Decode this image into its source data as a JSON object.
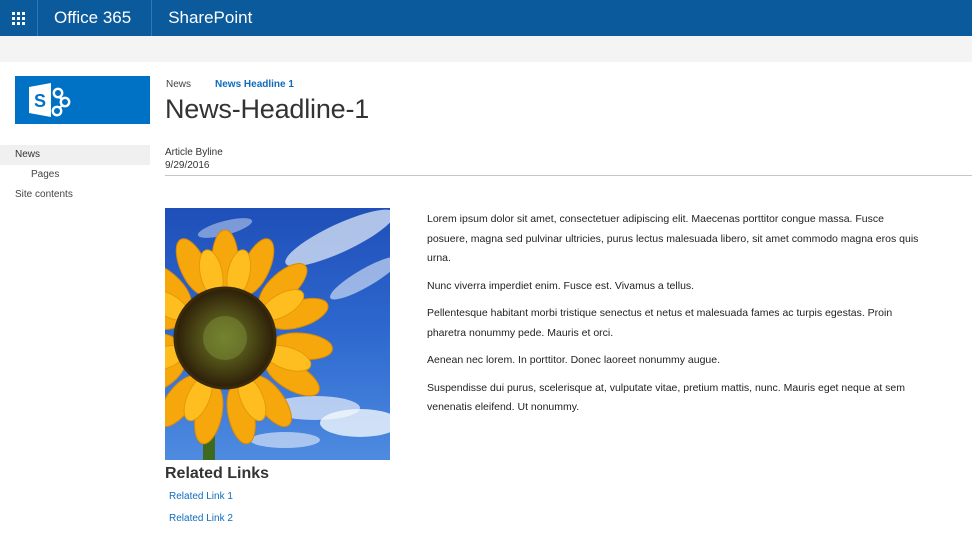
{
  "suite_bar": {
    "brand": "Office 365",
    "app": "SharePoint",
    "icon": "app-launcher-icon"
  },
  "site": {
    "logo_icon": "sharepoint-logo-icon",
    "logo_letter": "S",
    "logo_color": "#0072c6"
  },
  "breadcrumb": {
    "root": "News",
    "current": "News Headline 1"
  },
  "page": {
    "title": "News-Headline-1",
    "byline_label": "Article Byline",
    "date": "9/29/2016"
  },
  "left_nav": {
    "items": [
      {
        "label": "News"
      },
      {
        "label": "Pages"
      },
      {
        "label": "Site contents"
      }
    ]
  },
  "image": {
    "icon": "sunflower-image"
  },
  "related": {
    "title": "Related Links",
    "links": [
      {
        "label": "Related Link 1"
      },
      {
        "label": "Related Link 2"
      }
    ]
  },
  "article": {
    "paragraphs": [
      "Lorem ipsum dolor sit amet, consectetuer adipiscing elit. Maecenas porttitor congue massa. Fusce posuere, magna sed pulvinar ultricies, purus lectus malesuada libero, sit amet commodo magna eros quis urna.",
      "Nunc viverra imperdiet enim. Fusce est. Vivamus a tellus.",
      "Pellentesque habitant morbi tristique senectus et netus et malesuada fames ac turpis egestas. Proin pharetra nonummy pede. Mauris et orci.",
      "Aenean nec lorem. In porttitor. Donec laoreet nonummy augue.",
      "Suspendisse dui purus, scelerisque at, vulputate vitae, pretium mattis, nunc. Mauris eget neque at sem venenatis eleifend. Ut nonummy."
    ]
  },
  "colors": {
    "suite_bar": "#0a5a9c",
    "link": "#0f6cbd"
  }
}
